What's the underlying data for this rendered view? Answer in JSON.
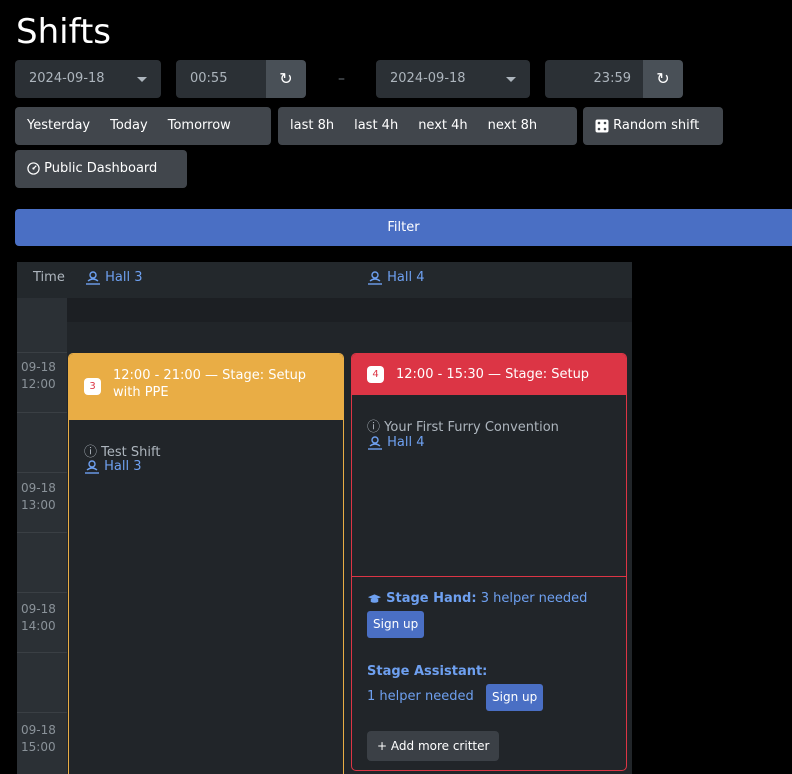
{
  "page": {
    "title": "Shifts"
  },
  "range": {
    "start_date": "2024-09-18",
    "start_time": "00:55",
    "separator": "–",
    "end_date": "2024-09-18",
    "end_time": "23:59"
  },
  "quick": {
    "yesterday": "Yesterday",
    "today": "Today",
    "tomorrow": "Tomorrow",
    "last8h": "last 8h",
    "last4h": "last 4h",
    "next4h": "next 4h",
    "next8h": "next 8h",
    "random": "Random shift",
    "public_dashboard": "Public Dashboard"
  },
  "filter_label": "Filter",
  "schedule": {
    "time_header": "Time",
    "locations": [
      "Hall 3",
      "Hall 4"
    ],
    "time_labels": [
      {
        "date": "09-18",
        "time": "12:00"
      },
      {
        "date": "09-18",
        "time": "13:00"
      },
      {
        "date": "09-18",
        "time": "14:00"
      },
      {
        "date": "09-18",
        "time": "15:00"
      }
    ],
    "shifts": [
      {
        "count": "3",
        "title": "12:00 - 21:00 — Stage: Setup with PPE",
        "description": "Test Shift",
        "location": "Hall 3",
        "color": "#e9ad45"
      },
      {
        "count": "4",
        "title": "12:00 - 15:30 — Stage: Setup",
        "description": "Your First Furry Convention",
        "location": "Hall 4",
        "color": "#dc3545",
        "needs": [
          {
            "role": "Stage Hand:",
            "text": "3 helper needed",
            "button": "Sign up"
          },
          {
            "role": "Stage Assistant:",
            "text": "1 helper needed",
            "button": "Sign up"
          }
        ],
        "add_more": "Add more critter"
      }
    ]
  }
}
